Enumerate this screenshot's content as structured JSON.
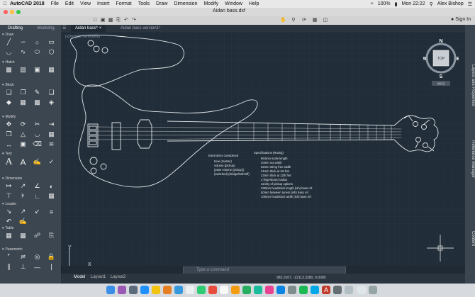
{
  "menubar": {
    "items": [
      "AutoCAD 2018",
      "File",
      "Edit",
      "View",
      "Insert",
      "Format",
      "Tools",
      "Draw",
      "Dimension",
      "Modify",
      "Window",
      "Help"
    ],
    "status": {
      "battery": "100%",
      "time": "Mon 22:22",
      "user": "Alex Bishop"
    }
  },
  "window": {
    "title": "Aidan bass.dxf",
    "sign_in": "Sign In"
  },
  "palette": {
    "tabs": [
      "Drafting",
      "Modeling"
    ],
    "sections": [
      "Draw",
      "Hatch",
      "Block",
      "Modify",
      "Text",
      "Dimension",
      "Leader",
      "Table",
      "Parametric"
    ]
  },
  "doc_tabs": [
    "Aidan bass*",
    "Aidan bass version1*"
  ],
  "view_label": "[-][Top][2D Wireframe]",
  "viewcube": {
    "n": "N",
    "s": "S",
    "e": "E",
    "w": "W",
    "top": "TOP",
    "wcs": "WCS"
  },
  "right_panel": [
    "Layers and Properties",
    "Reference Manager",
    "Content"
  ],
  "electronics": {
    "title": "Electronics considered",
    "items": [
      "tone (master)",
      "volume (pickup)",
      "(pass volume (pickup))",
      "(switched) (bridge/both/off)"
    ]
  },
  "specifications": {
    "title": "Specifications (Rating)",
    "items": [
      "864mm scale length",
      "40mm nut width",
      "62mm string free width",
      "21mm thick at 1st fret",
      "23mm thick at 12th fret",
      "2 fingerboard radius",
      "variety of pickup options",
      "230mm headstock length (ish) bass ref.",
      "50mm between tuners (ish) bass ref.",
      "100mm headstock width (ish) bass ref."
    ]
  },
  "command": {
    "placeholder": "Type a command"
  },
  "layout_tabs": [
    "Model",
    "Layout1",
    "Layout2"
  ],
  "coords": "983.0167, -22113.3280, 0.0000",
  "axes": {
    "y": "Y",
    "x": "X"
  },
  "colors": {
    "canvas": "#212d38",
    "grid": "#2c3a47",
    "line": "#e4e8ec",
    "accent": "#1e90ff"
  }
}
